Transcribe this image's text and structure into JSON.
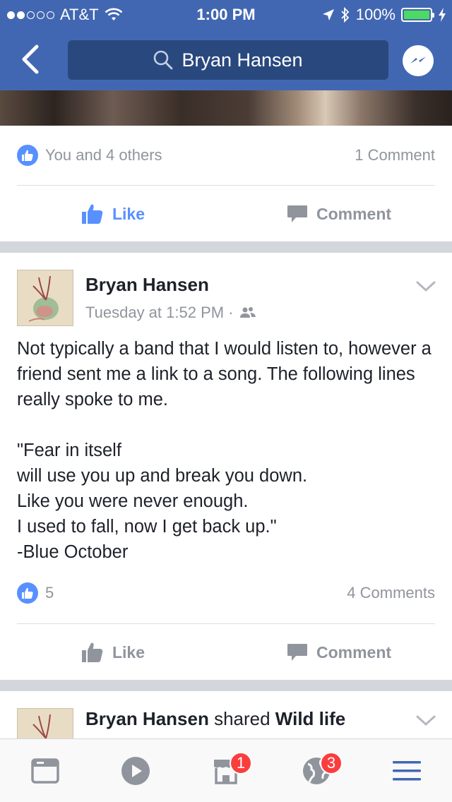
{
  "status_bar": {
    "carrier": "AT&T",
    "time": "1:00 PM",
    "battery": "100%",
    "signal_bars_filled": 2,
    "signal_bars_total": 5
  },
  "nav": {
    "search_text": "Bryan Hansen"
  },
  "post1": {
    "reactions_text": "You and 4 others",
    "comments_text": "1 Comment",
    "like_label": "Like",
    "comment_label": "Comment"
  },
  "post2": {
    "author": "Bryan Hansen",
    "timestamp": "Tuesday at 1:52 PM ·",
    "body": "Not typically a band that I would listen to, however a friend sent me a link to a song. The following lines really spoke to me.\n\n\"Fear in itself\nwill use you up and break you down.\nLike you were never enough.\nI used to fall, now I get back up.\"\n-Blue October",
    "reactions_count": "5",
    "comments_text": "4 Comments",
    "like_label": "Like",
    "comment_label": "Comment"
  },
  "post3": {
    "author": "Bryan Hansen",
    "shared_text": " shared ",
    "shared_object": "Wild life"
  },
  "tabbar": {
    "items": [
      {
        "name": "news-feed",
        "badge": ""
      },
      {
        "name": "video",
        "badge": ""
      },
      {
        "name": "marketplace",
        "badge": "1"
      },
      {
        "name": "notifications",
        "badge": "3"
      },
      {
        "name": "menu",
        "badge": ""
      }
    ]
  },
  "colors": {
    "brand": "#4267b2",
    "search_bg": "#29487d",
    "like_blue": "#5890ff",
    "secondary_text": "#90949c",
    "badge_red": "#fa3e3e"
  }
}
